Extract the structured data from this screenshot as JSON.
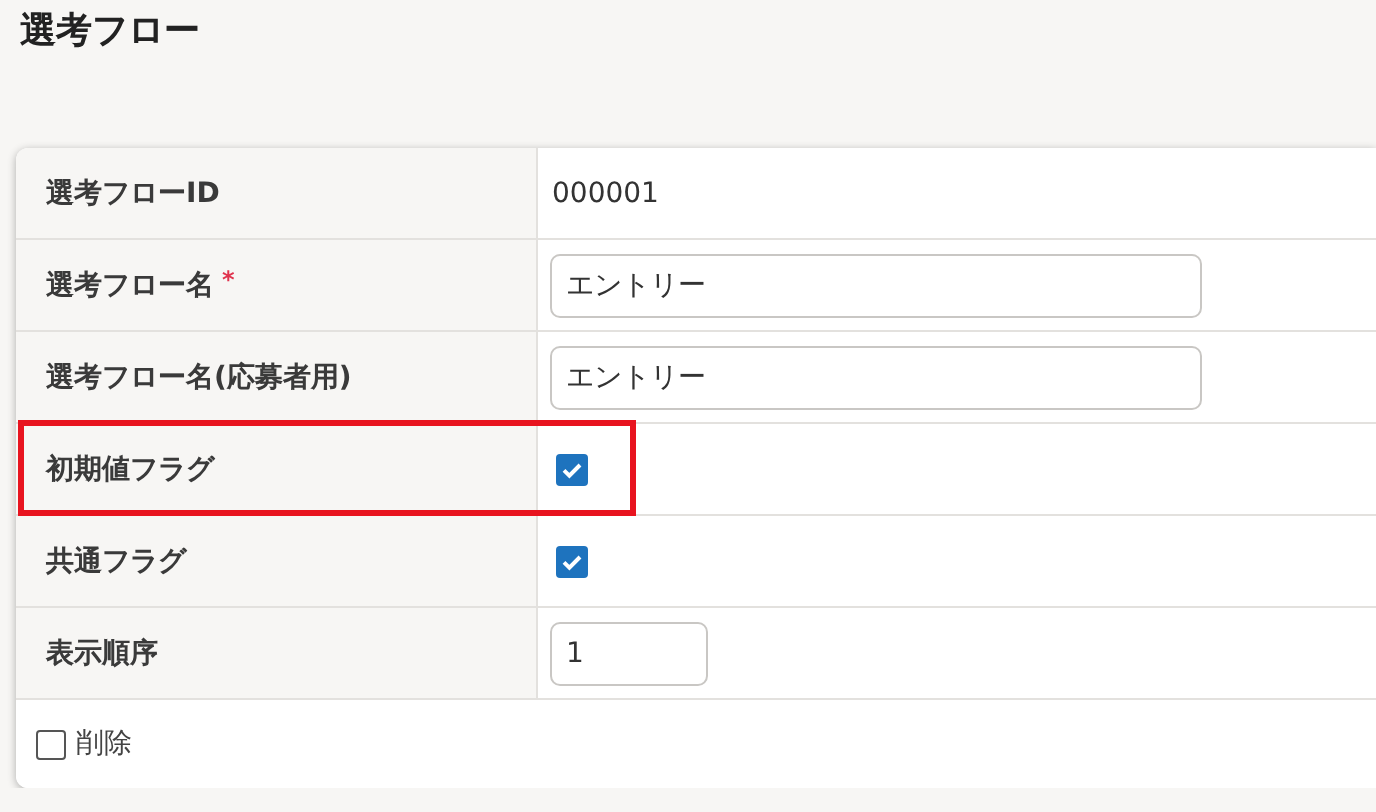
{
  "page": {
    "title": "選考フロー"
  },
  "rows": [
    {
      "kind": "text",
      "label": "選考フローID",
      "highlighted": false,
      "value": "000001"
    },
    {
      "kind": "input",
      "label": "選考フロー名",
      "required_mark": "*",
      "highlighted": false,
      "value": "エントリー"
    },
    {
      "kind": "input",
      "label": "選考フロー名(応募者用)",
      "highlighted": false,
      "value": "エントリー"
    },
    {
      "kind": "checkbox",
      "label": "初期値フラグ",
      "highlighted": true,
      "checked": true
    },
    {
      "kind": "checkbox",
      "label": "共通フラグ",
      "highlighted": false,
      "checked": true
    },
    {
      "kind": "small-input",
      "label": "表示順序",
      "highlighted": false,
      "value": "1"
    }
  ],
  "footer": {
    "delete": {
      "label": "削除",
      "checked": false
    }
  }
}
